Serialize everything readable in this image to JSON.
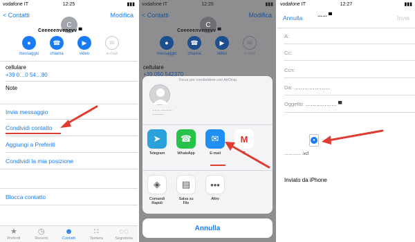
{
  "panel1": {
    "status": {
      "carrier": "vodafone IT",
      "time": "12:25",
      "battery": "▮▮▮"
    },
    "nav": {
      "back": "< Contatti",
      "edit": "Modifica"
    },
    "avatar_initial": "C",
    "contact_name": "Ceeeeenvenevv ▀",
    "actions": [
      {
        "label": "messaggio",
        "icon": "●"
      },
      {
        "label": "chiama",
        "icon": "☎"
      },
      {
        "label": "video",
        "icon": "▶"
      },
      {
        "label": "e-mail",
        "icon": "✉"
      }
    ],
    "cellulare_label": "cellulare",
    "phone": "+39 0…0 54…80",
    "note_label": "Note",
    "links": [
      "Invia messaggio",
      "Condividi contatto",
      "Aggiungi a Preferiti",
      "Condividi la mia posizione"
    ],
    "block": "Blocca contatto",
    "tabs": [
      {
        "label": "Preferiti",
        "icon": "★"
      },
      {
        "label": "Recenti",
        "icon": "◷"
      },
      {
        "label": "Contatti",
        "icon": "☻"
      },
      {
        "label": "Tastiera",
        "icon": "∷"
      },
      {
        "label": "Segreteria",
        "icon": "◌◌"
      }
    ]
  },
  "panel2": {
    "status": {
      "carrier": "vodafone IT",
      "time": "12:25",
      "battery": "▮▮▮"
    },
    "nav": {
      "back": "< Contatti",
      "edit": "Modifica"
    },
    "cellulare_label": "cellulare",
    "phone": "+39 050 542370",
    "airdrop_title": "Tocca per condividere con AirDrop",
    "airdrop_name": "…… ……… ………",
    "apps": [
      {
        "label": "Telegram",
        "icon": "➤",
        "color": "#2aa1db"
      },
      {
        "label": "WhatsApp",
        "icon": "☎",
        "color": "#26c24a"
      },
      {
        "label": "E-mail",
        "icon": "✉",
        "color": "#1f8ff4"
      },
      {
        "label": "G",
        "icon": "M",
        "color": "#ffffff"
      }
    ],
    "actions": [
      {
        "label": "Comandi Rapidi",
        "icon": "◈"
      },
      {
        "label": "Salva su File",
        "icon": "▤"
      },
      {
        "label": "Altro",
        "icon": "•••"
      }
    ],
    "cancel": "Annulla"
  },
  "panel3": {
    "status": {
      "carrier": "vodafone IT",
      "time": "12:27",
      "battery": "▮▮▮"
    },
    "cancel": "Annulla",
    "subject_title": "…… ▀",
    "send": "Invia",
    "fields": [
      {
        "label": "A:",
        "value": ""
      },
      {
        "label": "Cc:",
        "value": ""
      },
      {
        "label": "Ccn:",
        "value": ""
      },
      {
        "label": "Da:",
        "value": "…………………"
      },
      {
        "label": "Oggetto:",
        "value": "……………… ▀"
      }
    ],
    "attachment_name": "………… .vcf",
    "signature": "Inviato da iPhone"
  },
  "accent": "#1a7cf5",
  "arrow_color": "#e03b30"
}
